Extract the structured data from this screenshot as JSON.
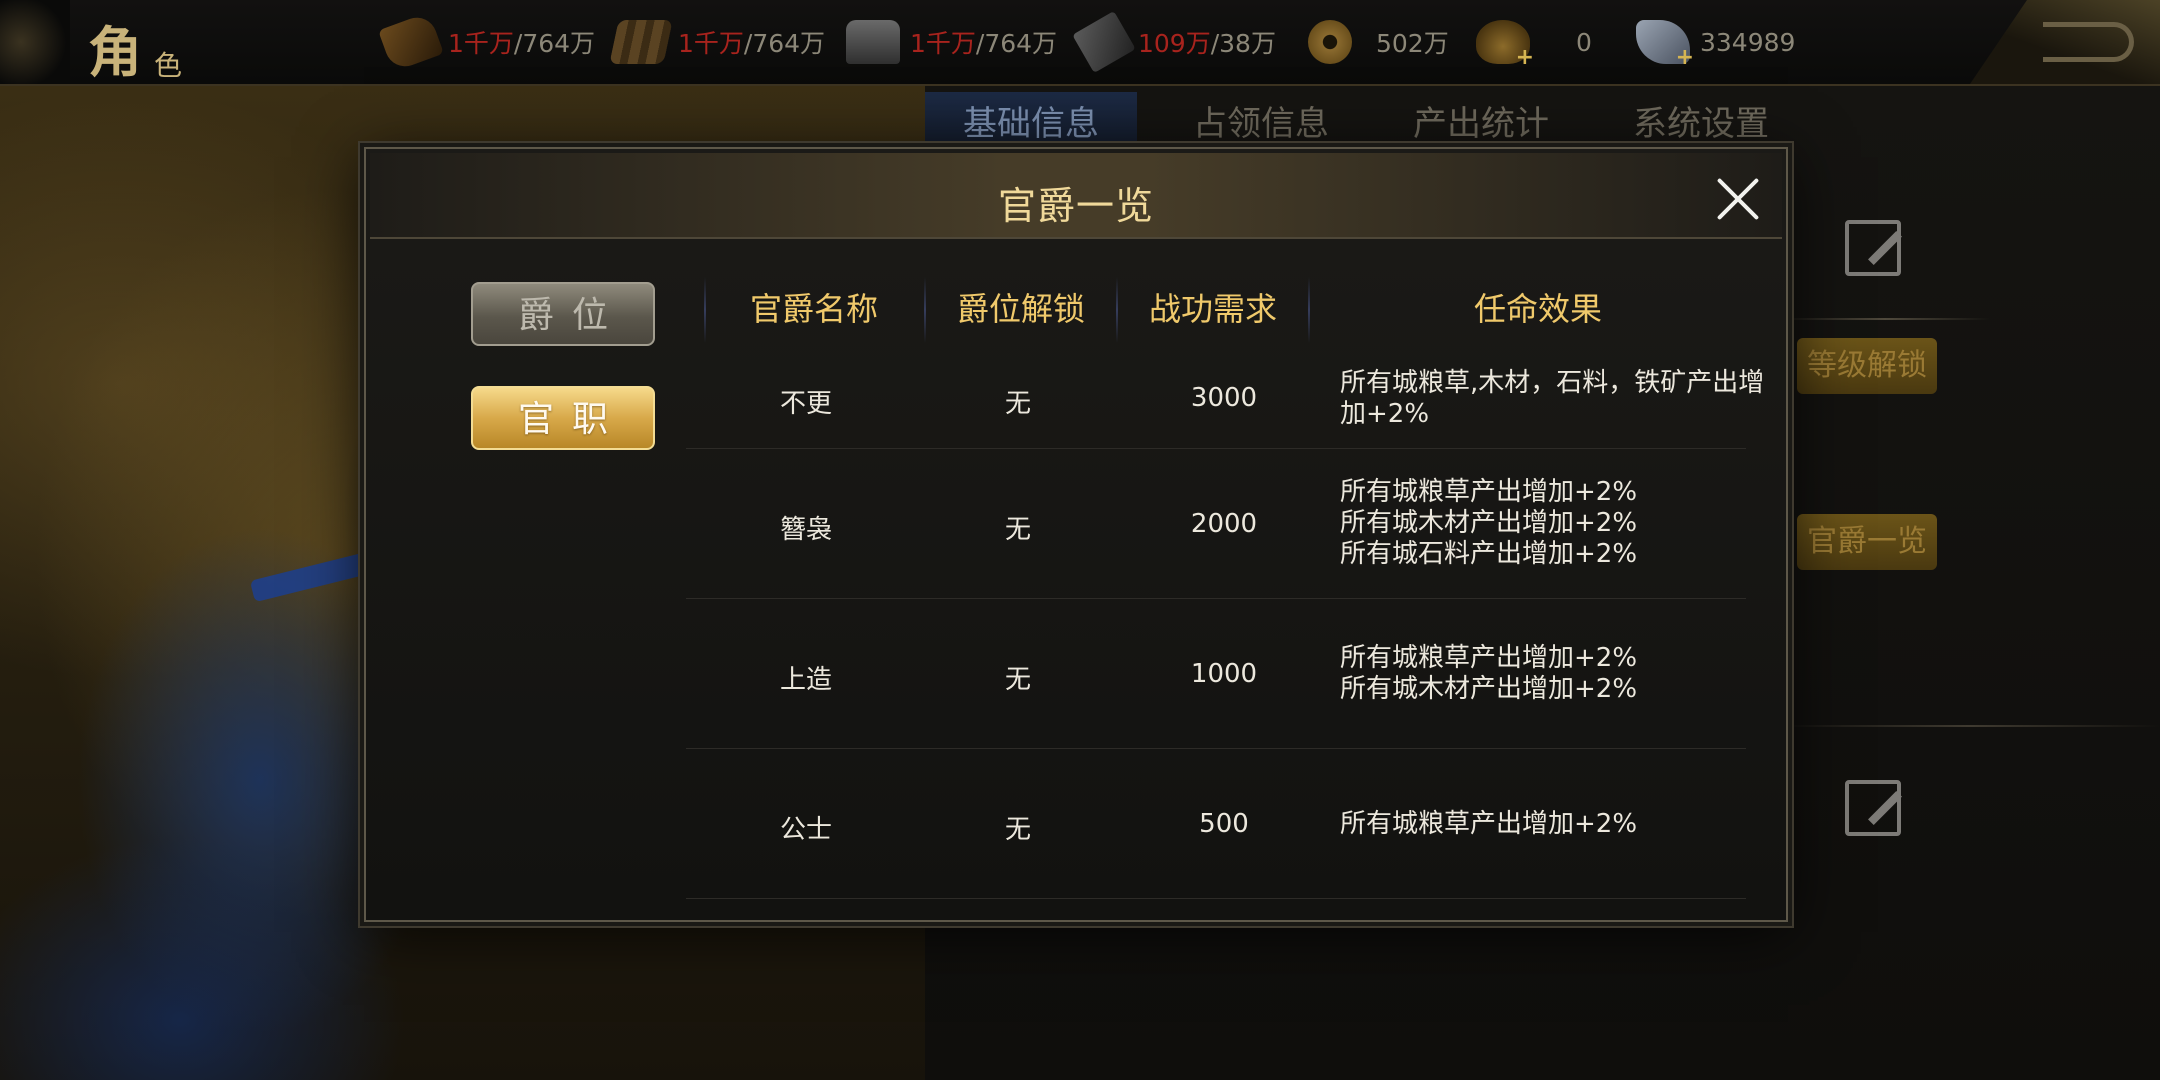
{
  "topbar": {
    "title_main": "角",
    "title_sub": "色",
    "resources": [
      {
        "icon": "grain-icon",
        "value_red": "1千万",
        "value_rest": "/764万"
      },
      {
        "icon": "wood-icon",
        "value_red": "1千万",
        "value_rest": "/764万"
      },
      {
        "icon": "stone-icon",
        "value_red": "1千万",
        "value_rest": "/764万"
      },
      {
        "icon": "iron-icon",
        "value_red": "109万",
        "value_rest": "/38万"
      },
      {
        "icon": "coin-icon",
        "value_red": "",
        "value_rest": "502万"
      },
      {
        "icon": "bag-icon",
        "value_red": "",
        "value_rest": "0"
      },
      {
        "icon": "gem-icon",
        "value_red": "",
        "value_rest": "334989"
      }
    ]
  },
  "background": {
    "tabs": [
      "基础信息",
      "占领信息",
      "产出统计",
      "系统设置"
    ],
    "button_level_unlock": "等级解锁",
    "button_rank_overview": "官爵一览"
  },
  "modal": {
    "title": "官爵一览",
    "side_buttons": {
      "rank": "爵位",
      "office": "官职"
    },
    "columns": [
      "官爵名称",
      "爵位解锁",
      "战功需求",
      "任命效果"
    ],
    "rows": [
      {
        "name": "不更",
        "unlock": "无",
        "merit": "3000",
        "effects": [
          "所有城粮草,木材，石料，铁矿产出增",
          "加+2%"
        ]
      },
      {
        "name": "簪袅",
        "unlock": "无",
        "merit": "2000",
        "effects": [
          "所有城粮草产出增加+2%",
          "所有城木材产出增加+2%",
          "所有城石料产出增加+2%"
        ]
      },
      {
        "name": "上造",
        "unlock": "无",
        "merit": "1000",
        "effects": [
          "所有城粮草产出增加+2%",
          "所有城木材产出增加+2%"
        ]
      },
      {
        "name": "公士",
        "unlock": "无",
        "merit": "500",
        "effects": [
          "所有城粮草产出增加+2%"
        ]
      }
    ]
  },
  "colors": {
    "header_gold": "#f0c96b",
    "title_gold": "#f0d99a",
    "deficit_red": "#a8231d",
    "active_button_gold": "#d8a94a"
  }
}
